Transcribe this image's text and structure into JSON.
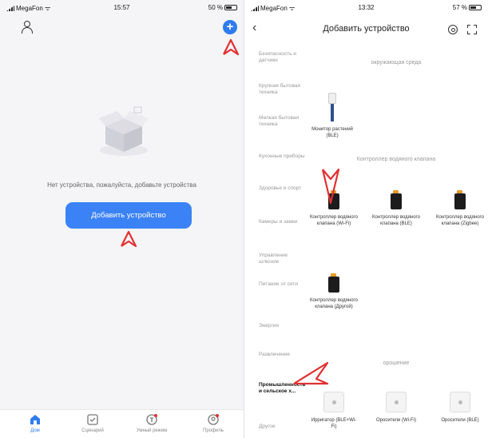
{
  "left": {
    "status": {
      "carrier": "MegaFon",
      "time": "15:57",
      "battery": "50 %"
    },
    "empty_text": "Нет устройства, пожалуйста, добавьте устройства",
    "add_device_button": "Добавить устройство",
    "tabs": [
      {
        "label": "Дом",
        "icon": "home-icon",
        "active": true
      },
      {
        "label": "Сценарий",
        "icon": "checkbox-icon",
        "active": false
      },
      {
        "label": "Умный режим",
        "icon": "smart-mode-icon",
        "active": false
      },
      {
        "label": "Профиль",
        "icon": "profile-icon",
        "active": false
      }
    ],
    "accent_color": "#2f7bf0",
    "arrow_color": "#e03030"
  },
  "right": {
    "status": {
      "carrier": "MegaFon",
      "time": "13:32",
      "battery": "57 %"
    },
    "title": "Добавить устройство",
    "categories": [
      {
        "label": "Безопасность и датчики",
        "active": false
      },
      {
        "label": "Крупная бытовая техника",
        "active": false
      },
      {
        "label": "Мелкая бытовая техника",
        "active": false
      },
      {
        "label": "Кухонные приборы",
        "active": false
      },
      {
        "label": "Здоровье и спорт",
        "active": false
      },
      {
        "label": "Камеры и замки",
        "active": false
      },
      {
        "label": "Управление шлюзом",
        "active": false
      },
      {
        "label": "Питание от сети",
        "active": false
      },
      {
        "label": "Энергия",
        "active": false
      },
      {
        "label": "Развлечение",
        "active": false
      },
      {
        "label": "Промышленность и сельское х...",
        "active": true
      },
      {
        "label": "Другое",
        "active": false
      }
    ],
    "sections": [
      {
        "title": "окружающая среда"
      },
      {
        "title": "Контроллер водяного клапана"
      },
      {
        "title": "орошение"
      }
    ],
    "devices": {
      "monitor": "Монитор растений (BLE)",
      "valve_wifi": "Контроллер водяного клапана (Wi-Fi)",
      "valve_ble": "Контроллер водяного клапана (BLE)",
      "valve_zigbee": "Контроллер водяного клапана (Zigbee)",
      "valve_other": "Контроллер водяного клапана (Другой)",
      "irrigator": "Ирригатор (BLE+Wi-Fi)",
      "sprinkler_wifi": "Оросители (Wi-Fi)",
      "sprinkler_ble": "Оросители (BLE)"
    }
  }
}
